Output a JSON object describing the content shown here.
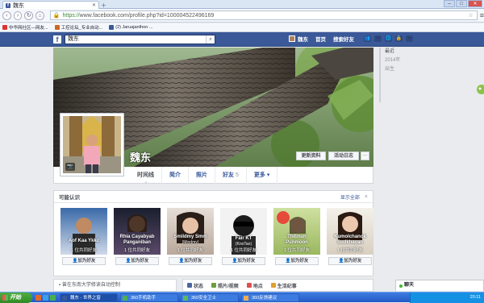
{
  "browser": {
    "tab_title": "魏东",
    "url_proto": "https://",
    "url_rest": "www.facebook.com/profile.php?id=100004522496169",
    "bookmarks": [
      "中华网社区—网友...",
      "工控论坛_专业自动...",
      "(2) Jaruajanthon ..."
    ]
  },
  "fb_header": {
    "logo": "f",
    "search_value": "魏东",
    "user_name": "魏东",
    "home_label": "首页",
    "find_friends_label": "搜索好友"
  },
  "profile": {
    "name": "魏东",
    "update_info_label": "更新资料",
    "activity_log_label": "活动日志",
    "more_label": "···",
    "tabs": {
      "timeline": "时间线",
      "about": "简介",
      "photos": "照片",
      "friends": "好友",
      "friends_count": "5",
      "more": "更多 ▾"
    }
  },
  "timeline_years": [
    "最近",
    "2014年",
    "出生"
  ],
  "pymk": {
    "title": "可能认识",
    "see_all": "显示全部",
    "close": "×",
    "add_label": "加为好友",
    "people": [
      {
        "name1": "Aof Kaa Ykkc",
        "name2": "",
        "mutual": "1 位共同好友"
      },
      {
        "name1": "Rhia Cayabyab",
        "name2": "Panganiban",
        "mutual": "1 位共同好友"
      },
      {
        "name1": "Smildmy Smm",
        "name2": "(Mindmy)",
        "mutual": "1 位共同好友"
      },
      {
        "name1": "Fair KT",
        "name2": "(KnoTao)",
        "mutual": "1 位共同好友"
      },
      {
        "name1": "Thitinun",
        "name2": "Punmoon",
        "mutual": "1 位共同好友"
      },
      {
        "name1": "Kumolchanok",
        "name2": "Sudkhayan",
        "mutual": "1 位共同好友"
      }
    ]
  },
  "left_box": "曾在东南大学修读自动控制",
  "composer": {
    "status": "状态",
    "photo": "照片/视频",
    "place": "地点",
    "life_event": "生活纪事"
  },
  "chat": {
    "label": "聊天"
  },
  "taskbar": {
    "start": "开始",
    "tasks": [
      "魏东 - 世界之窗",
      "360手机助手",
      "360安全卫士",
      "360反馈建议"
    ],
    "clock": "20:11"
  },
  "colors": {
    "fb_blue": "#3b5998",
    "link": "#365899"
  }
}
